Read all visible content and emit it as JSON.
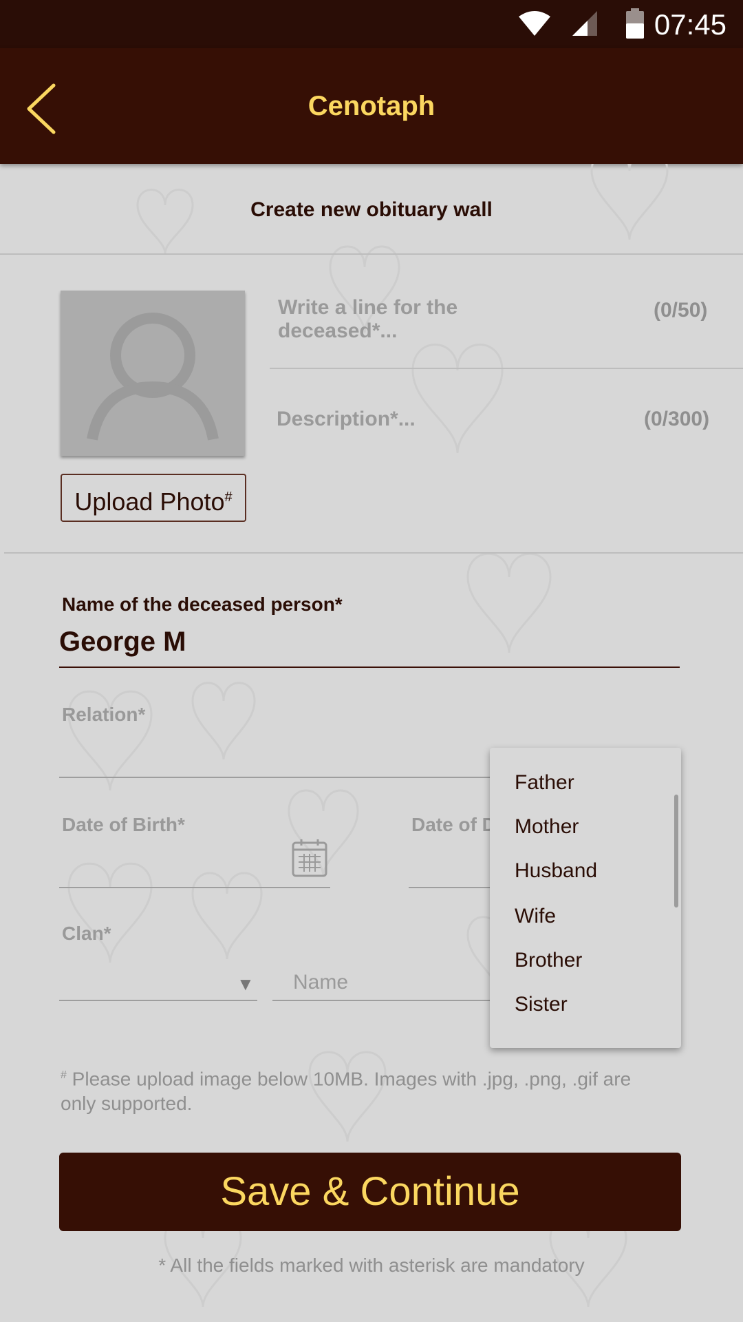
{
  "status_bar": {
    "time": "07:45"
  },
  "app_bar": {
    "title": "Cenotaph"
  },
  "form": {
    "section_title": "Create new obituary wall",
    "upload_photo_label": "Upload Photo",
    "upload_photo_mark": "#",
    "tagline": {
      "placeholder": "Write a line for the deceased*...",
      "counter": "(0/50)"
    },
    "description": {
      "placeholder": "Description*...",
      "counter": "(0/300)"
    },
    "name": {
      "label": "Name of the deceased person*",
      "value": "George M"
    },
    "relation": {
      "label": "Relation*"
    },
    "dob": {
      "label": "Date of Birth*"
    },
    "dod": {
      "label": "Date of D"
    },
    "clan": {
      "label": "Clan*",
      "name_placeholder": "Name"
    },
    "footnote_mark": "#",
    "footnote": " Please upload image below 10MB. Images with .jpg, .png, .gif are only supported.",
    "save_button": "Save & Continue",
    "mandatory_note": "* All the fields marked with asterisk are mandatory"
  },
  "relation_dropdown": {
    "options": [
      "Father",
      "Mother",
      "Husband",
      "Wife",
      "Brother",
      "Sister"
    ]
  },
  "colors": {
    "primary": "#360f05",
    "accent": "#fbd760",
    "background": "#d7d7d7"
  }
}
